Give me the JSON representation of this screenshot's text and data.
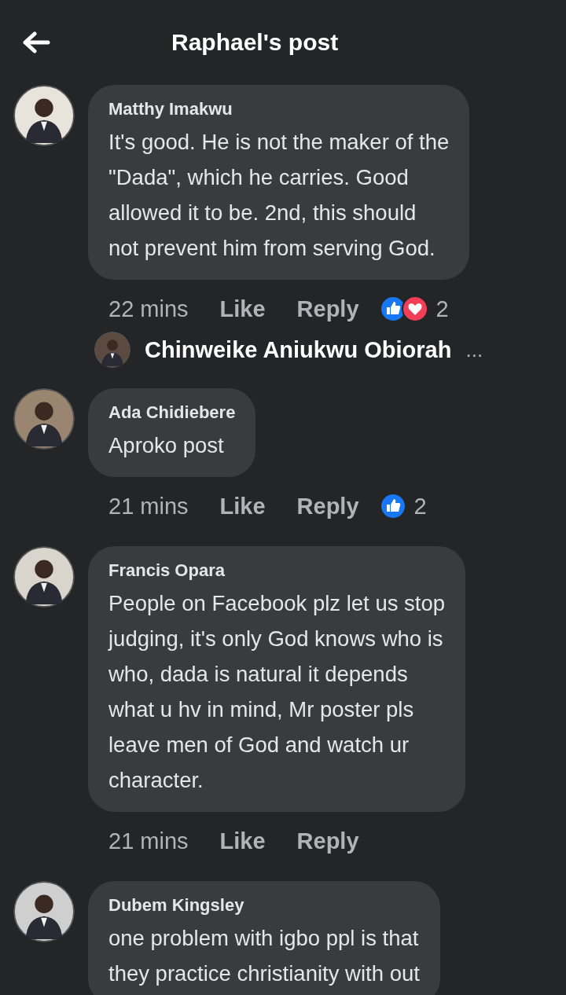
{
  "header": {
    "title": "Raphael's post"
  },
  "comments": [
    {
      "author": "Matthy Imakwu",
      "lines": [
        "It's good. He is not the maker of the",
        "\"Dada\", which he carries. Good",
        "allowed it to be. 2nd, this should",
        "not prevent him from serving God."
      ],
      "time": "22 mins",
      "like": "Like",
      "reply": "Reply",
      "reactions": [
        {
          "kind": "like"
        },
        {
          "kind": "love"
        }
      ],
      "reaction_count": "2",
      "reply_preview": {
        "author": "Chinweike Aniukwu Obiorah",
        "more": "..."
      }
    },
    {
      "author": "Ada Chidiebere",
      "lines": [
        "Aproko post"
      ],
      "time": "21 mins",
      "like": "Like",
      "reply": "Reply",
      "reactions": [
        {
          "kind": "like"
        }
      ],
      "reaction_count": "2"
    },
    {
      "author": "Francis Opara",
      "lines": [
        "People on Facebook plz let us stop",
        "judging, it's only God knows who is",
        "who, dada is natural it depends",
        "what u hv in mind, Mr poster pls",
        "leave men of God and watch ur",
        "character."
      ],
      "time": "21 mins",
      "like": "Like",
      "reply": "Reply"
    },
    {
      "author": "Dubem Kingsley",
      "lines": [
        "one problem with igbo ppl is that",
        "they practice christianity with out"
      ]
    }
  ]
}
